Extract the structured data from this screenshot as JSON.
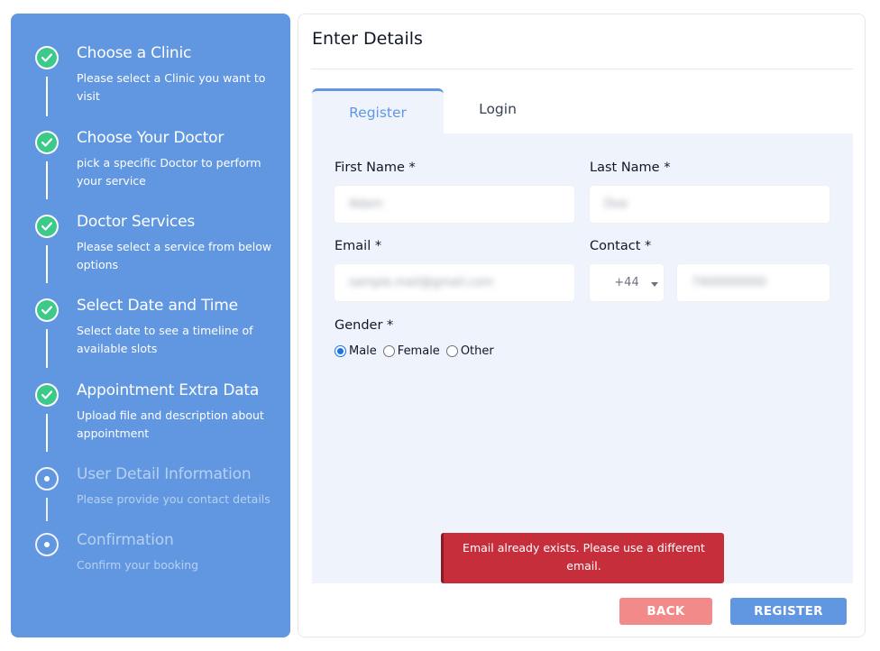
{
  "steps": [
    {
      "title": "Choose a Clinic",
      "desc": "Please select a Clinic you want to visit",
      "status": "done"
    },
    {
      "title": "Choose Your Doctor",
      "desc": "pick a specific Doctor to perform your service",
      "status": "done"
    },
    {
      "title": "Doctor Services",
      "desc": "Please select a service from below options",
      "status": "done"
    },
    {
      "title": "Select Date and Time",
      "desc": "Select date to see a timeline of available slots",
      "status": "done"
    },
    {
      "title": "Appointment Extra Data",
      "desc": "Upload file and description about appointment",
      "status": "done"
    },
    {
      "title": "User Detail Information",
      "desc": "Please provide you contact details",
      "status": "current"
    },
    {
      "title": "Confirmation",
      "desc": "Confirm your booking",
      "status": "pending"
    }
  ],
  "main": {
    "title": "Enter Details",
    "tabs": {
      "register": "Register",
      "login": "Login"
    }
  },
  "form": {
    "first_name_label": "First Name *",
    "first_name_value": "Adam",
    "last_name_label": "Last Name *",
    "last_name_value": "Doe",
    "email_label": "Email *",
    "email_value": "sample.mail@gmail.com",
    "contact_label": "Contact *",
    "country_code": "+44",
    "phone_value": "7400000000",
    "gender_label": "Gender *",
    "gender_options": [
      "Male",
      "Female",
      "Other"
    ],
    "gender_selected": "Male"
  },
  "alert": {
    "message": "Email already exists. Please use a different email."
  },
  "buttons": {
    "back": "BACK",
    "register": "REGISTER"
  },
  "colors": {
    "sidebar_bg": "#6197e0",
    "check_green": "#3cc98a",
    "alert_red": "#c72e3b",
    "back_button": "#f38a8a",
    "register_button": "#6197e0"
  }
}
